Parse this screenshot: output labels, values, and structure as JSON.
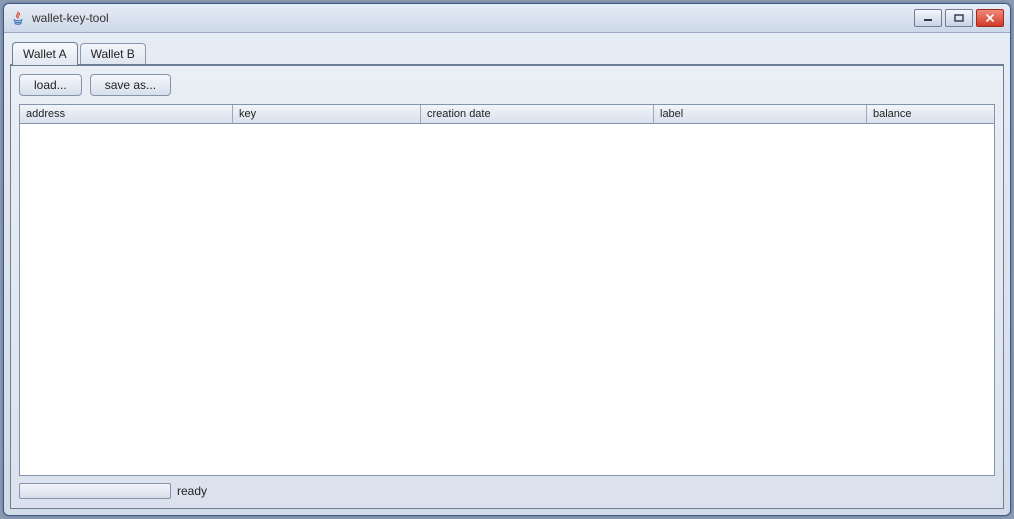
{
  "window": {
    "title": "wallet-key-tool"
  },
  "tabs": [
    {
      "label": "Wallet A",
      "active": true
    },
    {
      "label": "Wallet B",
      "active": false
    }
  ],
  "toolbar": {
    "load_label": "load...",
    "save_label": "save as..."
  },
  "table": {
    "columns": {
      "address": "address",
      "key": "key",
      "creation": "creation date",
      "label": "label",
      "balance": "balance"
    },
    "rows": []
  },
  "status": {
    "text": "ready",
    "progress": 0
  }
}
